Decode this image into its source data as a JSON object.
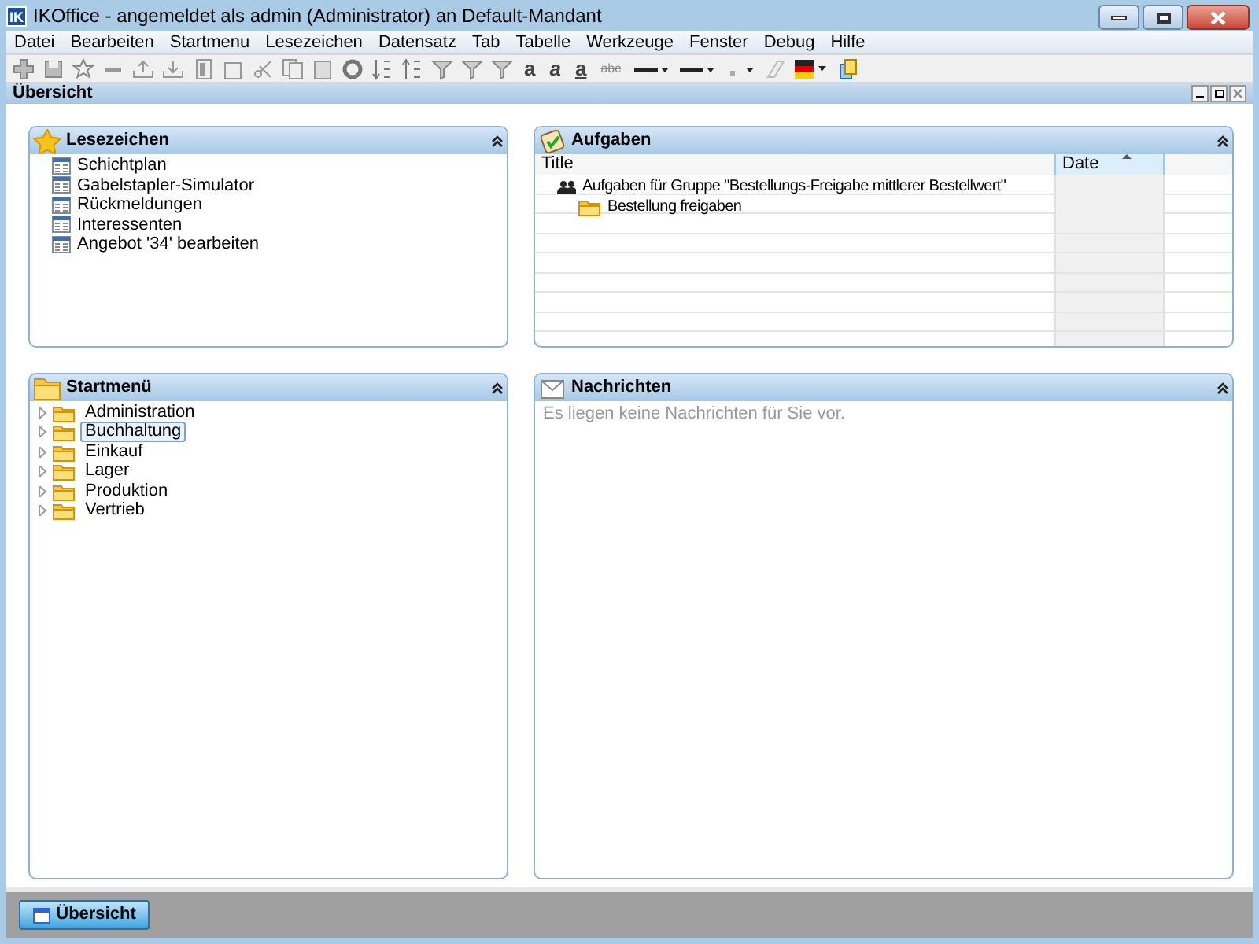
{
  "window": {
    "title": "IKOffice - angemeldet als admin (Administrator) an Default-Mandant",
    "logo": "IK"
  },
  "menu": [
    "Datei",
    "Bearbeiten",
    "Startmenu",
    "Lesezeichen",
    "Datensatz",
    "Tab",
    "Tabelle",
    "Werkzeuge",
    "Fenster",
    "Debug",
    "Hilfe"
  ],
  "toolbar_text": [
    "a",
    "a",
    "a",
    "abc"
  ],
  "inner_window": {
    "title": "Übersicht"
  },
  "bookmarks": {
    "title": "Lesezeichen",
    "items": [
      "Schichtplan",
      "Gabelstapler-Simulator",
      "Rückmeldungen",
      "Interessenten",
      "Angebot '34' bearbeiten"
    ]
  },
  "tasks": {
    "title": "Aufgaben",
    "columns": [
      {
        "label": "Title",
        "sorted": false
      },
      {
        "label": "Date",
        "sorted": true
      }
    ],
    "rows": [
      {
        "kind": "group",
        "title": "Aufgaben für Gruppe \"Bestellungs-Freigabe mittlerer Bestellwert\"",
        "children": [
          {
            "kind": "folder",
            "title": "Bestellung freigaben"
          }
        ]
      }
    ]
  },
  "start_menu": {
    "title": "Startmenü",
    "items": [
      {
        "label": "Administration",
        "expanded": false,
        "selected": false
      },
      {
        "label": "Buchhaltung",
        "expanded": false,
        "selected": true
      },
      {
        "label": "Einkauf",
        "expanded": false,
        "selected": false
      },
      {
        "label": "Lager",
        "expanded": false,
        "selected": false
      },
      {
        "label": "Produktion",
        "expanded": false,
        "selected": false
      },
      {
        "label": "Vertrieb",
        "expanded": false,
        "selected": false
      }
    ]
  },
  "messages": {
    "title": "Nachrichten",
    "empty_text": "Es liegen keine Nachrichten für Sie vor."
  },
  "taskbar": [
    {
      "label": "Übersicht",
      "selected": true
    }
  ]
}
